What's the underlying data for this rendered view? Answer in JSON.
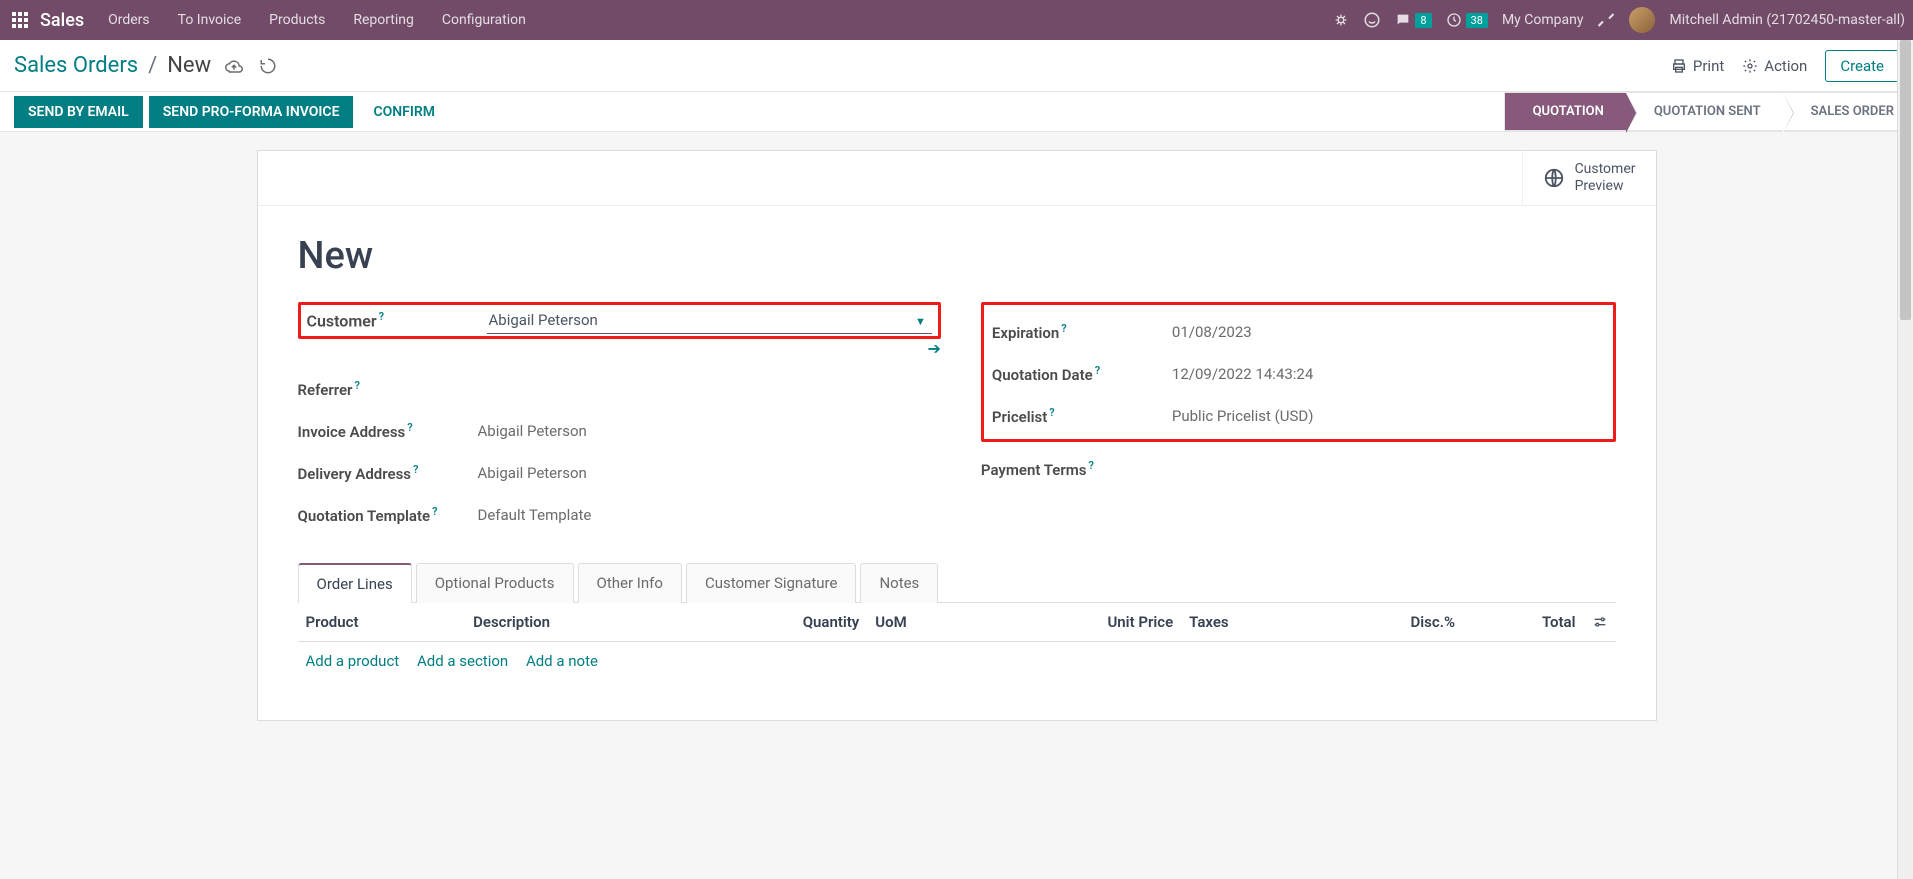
{
  "topnav": {
    "brand": "Sales",
    "items": [
      "Orders",
      "To Invoice",
      "Products",
      "Reporting",
      "Configuration"
    ],
    "msg_count": "8",
    "activity_count": "38",
    "company": "My Company",
    "user": "Mitchell Admin (21702450-master-all)"
  },
  "breadcrumb": {
    "parent": "Sales Orders",
    "current": "New"
  },
  "control": {
    "print": "Print",
    "action": "Action",
    "create": "Create"
  },
  "statusbar": {
    "send_email": "SEND BY EMAIL",
    "send_proforma": "SEND PRO-FORMA INVOICE",
    "confirm": "CONFIRM",
    "stages": [
      "QUOTATION",
      "QUOTATION SENT",
      "SALES ORDER"
    ]
  },
  "button_box": {
    "customer_preview_l1": "Customer",
    "customer_preview_l2": "Preview"
  },
  "form": {
    "title": "New",
    "labels": {
      "customer": "Customer",
      "referrer": "Referrer",
      "invoice_address": "Invoice Address",
      "delivery_address": "Delivery Address",
      "quotation_template": "Quotation Template",
      "expiration": "Expiration",
      "quotation_date": "Quotation Date",
      "pricelist": "Pricelist",
      "payment_terms": "Payment Terms"
    },
    "values": {
      "customer": "Abigail Peterson",
      "referrer": "",
      "invoice_address": "Abigail Peterson",
      "delivery_address": "Abigail Peterson",
      "quotation_template": "Default Template",
      "expiration": "01/08/2023",
      "quotation_date": "12/09/2022 14:43:24",
      "pricelist": "Public Pricelist (USD)",
      "payment_terms": ""
    }
  },
  "tabs": [
    "Order Lines",
    "Optional Products",
    "Other Info",
    "Customer Signature",
    "Notes"
  ],
  "table": {
    "headers": {
      "product": "Product",
      "description": "Description",
      "quantity": "Quantity",
      "uom": "UoM",
      "unit_price": "Unit Price",
      "taxes": "Taxes",
      "disc": "Disc.%",
      "total": "Total"
    },
    "add_product": "Add a product",
    "add_section": "Add a section",
    "add_note": "Add a note"
  }
}
